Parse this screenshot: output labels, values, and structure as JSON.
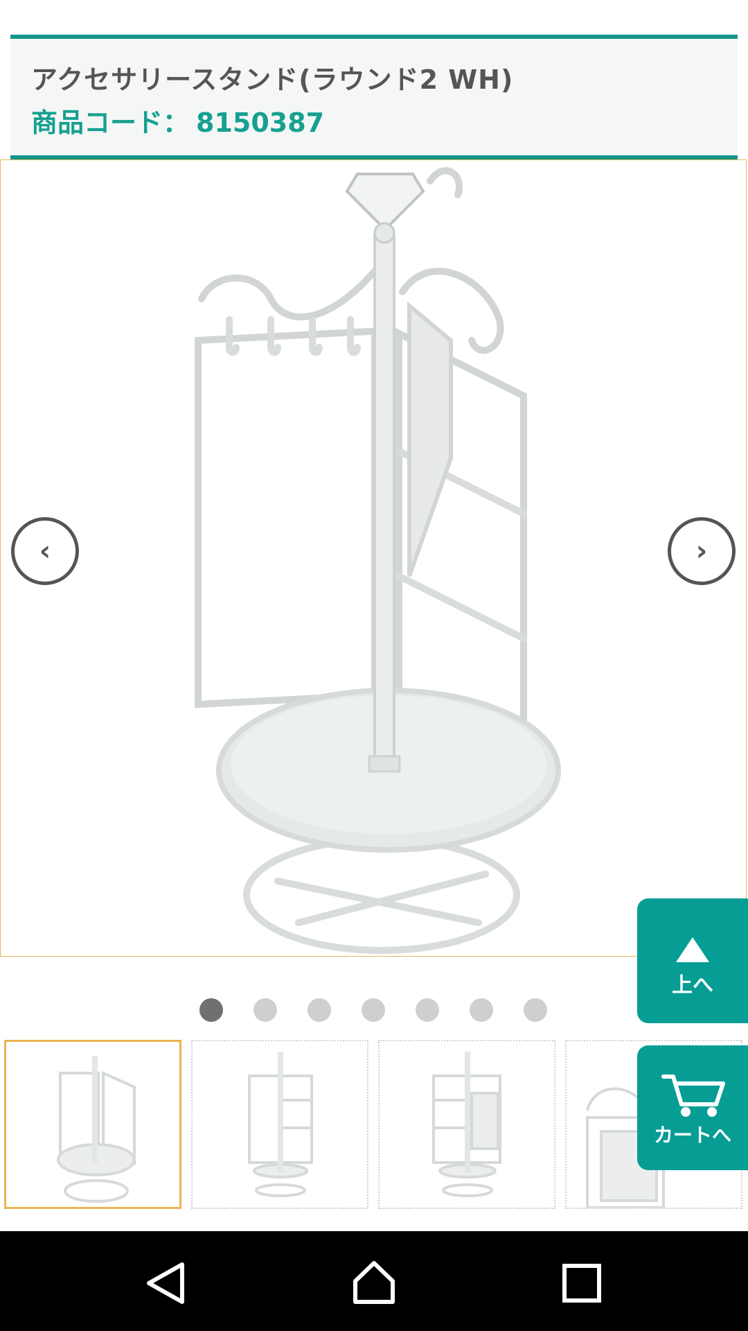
{
  "product": {
    "name": "アクセサリースタンド(ラウンド2 WH)",
    "code_label": "商品コード：",
    "code_value": "8150387"
  },
  "gallery": {
    "prev_icon": "chevron-left-icon",
    "next_icon": "chevron-right-icon",
    "dot_count": 7,
    "active_dot": 1,
    "thumbnail_count": 4,
    "active_thumbnail": 1
  },
  "floating": {
    "top_label": "上へ",
    "cart_label": "カートへ"
  },
  "colors": {
    "accent": "#069d95",
    "code_text": "#16a08f",
    "selected_border": "#eab454"
  }
}
